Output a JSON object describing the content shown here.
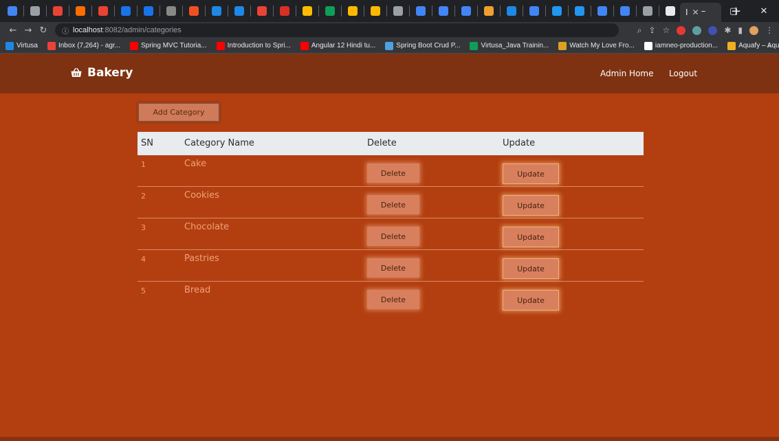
{
  "browser": {
    "tab_favicon_colors": [
      "#4285f4",
      "#9aa0a6",
      "#ea4335",
      "#ff6d00",
      "#ea4335",
      "#1a73e8",
      "#1a73e8",
      "#888888",
      "#f25022",
      "#1e88e5",
      "#1e88e5",
      "#ea4335",
      "#d93025",
      "#fbbc04",
      "#0f9d58",
      "#ffb900",
      "#ffb900",
      "#9aa0a6",
      "#4285f4",
      "#4285f4",
      "#4285f4",
      "#f0a030",
      "#1e88e5",
      "#4285f4",
      "#2196f3",
      "#2196f3",
      "#4285f4",
      "#4285f4",
      "#9aa0a6",
      "#e8eaed"
    ],
    "active_tab_label": "I",
    "url_host": "localhost",
    "url_path": ":8082/admin/categories",
    "bookmarks": [
      {
        "label": "Virtusa",
        "color": "#1e88e5"
      },
      {
        "label": "Inbox (7,264) - agr...",
        "color": "#ea4335"
      },
      {
        "label": "Spring MVC Tutoria...",
        "color": "#ff0000"
      },
      {
        "label": "Introduction to Spri...",
        "color": "#ff0000"
      },
      {
        "label": "Angular 12 Hindi tu...",
        "color": "#ff0000"
      },
      {
        "label": "Spring Boot Crud P...",
        "color": "#4fa0e0"
      },
      {
        "label": "Virtusa_Java Trainin...",
        "color": "#0f9d58"
      },
      {
        "label": "Watch My Love Fro...",
        "color": "#e0a020"
      },
      {
        "label": "iamneo-production...",
        "color": "#ffffff"
      },
      {
        "label": "Aquafy – Aqua Far...",
        "color": "#f0b020"
      }
    ],
    "bookmarks_more": "»"
  },
  "navbar": {
    "brand": "Bakery",
    "links": [
      "Admin Home",
      "Logout"
    ]
  },
  "page": {
    "add_button": "Add Category",
    "headers": {
      "sn": "SN",
      "name": "Category Name",
      "delete": "Delete",
      "update": "Update"
    },
    "rows": [
      {
        "sn": "1",
        "name": "Cake",
        "delete": "Delete",
        "update": "Update"
      },
      {
        "sn": "2",
        "name": "Cookies",
        "delete": "Delete",
        "update": "Update"
      },
      {
        "sn": "3",
        "name": "Chocolate",
        "delete": "Delete",
        "update": "Update"
      },
      {
        "sn": "4",
        "name": "Pastries",
        "delete": "Delete",
        "update": "Update"
      },
      {
        "sn": "5",
        "name": "Bread",
        "delete": "Delete",
        "update": "Update"
      }
    ]
  },
  "colors": {
    "page_bg": "#b33f10",
    "navbar_bg": "#7e3212",
    "button_bg": "#d8805e",
    "header_bg": "#e9ecef"
  }
}
